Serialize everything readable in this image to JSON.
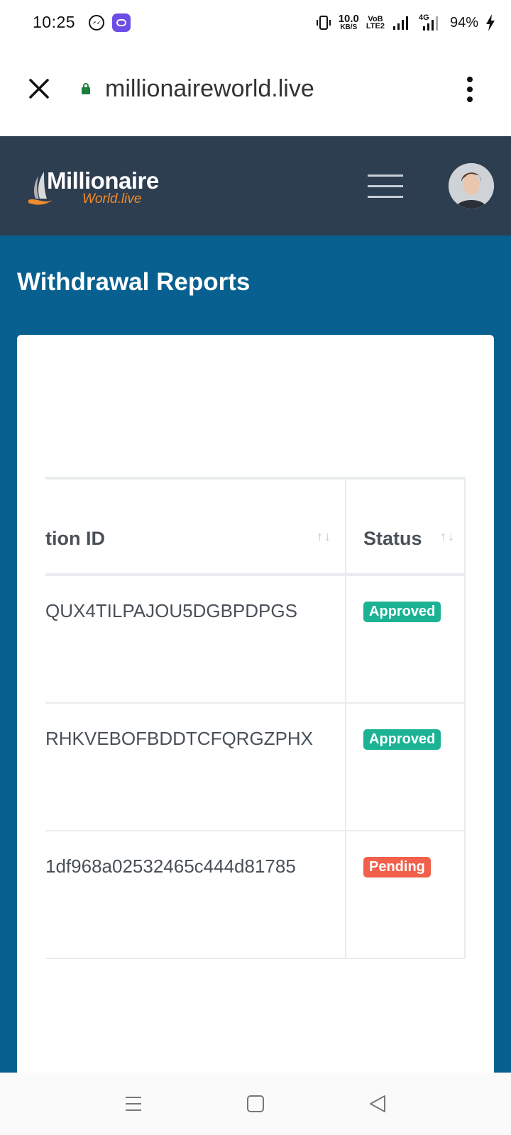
{
  "status_bar": {
    "time": "10:25",
    "speed_value": "10.0",
    "speed_unit": "KB/S",
    "volte_top": "VoB",
    "volte_bottom": "LTE2",
    "network": "4G",
    "battery": "94%"
  },
  "browser": {
    "url": "millionaireworld.live"
  },
  "header": {
    "logo_line1": "Millionaire",
    "logo_line2": "World.live"
  },
  "page": {
    "title": "Withdrawal Reports"
  },
  "table": {
    "columns": [
      {
        "label": "tion ID"
      },
      {
        "label": "Status"
      }
    ],
    "sort_glyph": "↑↓",
    "rows": [
      {
        "id": "QUX4TILPAJOU5DGBPDPGS",
        "status": "Approved"
      },
      {
        "id": "RHKVEBOFBDDTCFQRGZPHX",
        "status": "Approved"
      },
      {
        "id": "1df968a02532465c444d81785",
        "status": "Pending"
      }
    ]
  },
  "colors": {
    "header_bg": "#2d3e50",
    "main_bg": "#07608f",
    "approved": "#1bb394",
    "pending": "#f1604a",
    "logo_accent": "#f28a2e"
  }
}
